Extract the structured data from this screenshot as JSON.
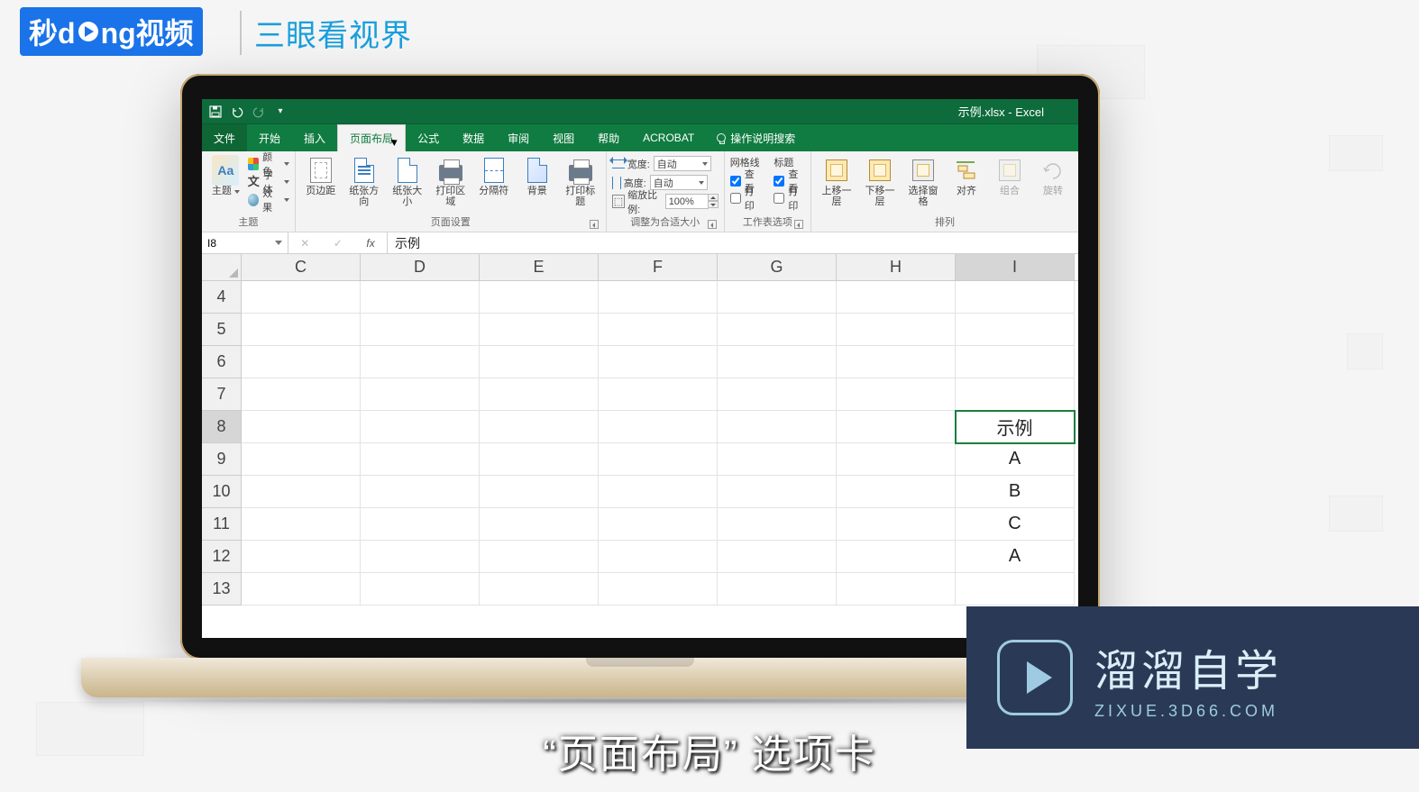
{
  "overlay": {
    "logo_left": "秒d",
    "logo_right": "ng视频",
    "tagline": "三眼看视界",
    "subtitle": "“页面布局” 选项卡"
  },
  "watermark": {
    "title": "溜溜自学",
    "url": "ZIXUE.3D66.COM"
  },
  "app": {
    "title": "示例.xlsx - Excel",
    "tabs": [
      "文件",
      "开始",
      "插入",
      "页面布局",
      "公式",
      "数据",
      "审阅",
      "视图",
      "帮助",
      "ACROBAT"
    ],
    "active_tab_index": 3,
    "tell_me": "操作说明搜索"
  },
  "ribbon": {
    "themes": {
      "group": "主题",
      "main": "主题",
      "colors": "颜色",
      "fonts": "字体",
      "effects": "效果"
    },
    "page_setup": {
      "group": "页面设置",
      "margins": "页边距",
      "orientation": "纸张方向",
      "size": "纸张大小",
      "print_area": "打印区域",
      "breaks": "分隔符",
      "background": "背景",
      "print_titles": "打印标题"
    },
    "scale": {
      "group": "调整为合适大小",
      "width_lbl": "宽度:",
      "height_lbl": "高度:",
      "scale_lbl": "缩放比例:",
      "auto": "自动",
      "percent": "100%"
    },
    "sheet_opts": {
      "group": "工作表选项",
      "gridlines": "网格线",
      "headings": "标题",
      "view": "查看",
      "print": "打印",
      "grid_view": true,
      "grid_print": false,
      "head_view": true,
      "head_print": false
    },
    "arrange": {
      "group": "排列",
      "forward": "上移一层",
      "backward": "下移一层",
      "selection": "选择窗格",
      "align": "对齐",
      "group_btn": "组合",
      "rotate": "旋转"
    }
  },
  "formula_bar": {
    "name_box": "I8",
    "value": "示例"
  },
  "grid": {
    "columns": [
      "C",
      "D",
      "E",
      "F",
      "G",
      "H",
      "I"
    ],
    "rows": [
      4,
      5,
      6,
      7,
      8,
      9,
      10,
      11,
      12,
      13
    ],
    "active": {
      "row": 8,
      "col": "I"
    },
    "cells": {
      "I8": "示例",
      "I9": "A",
      "I10": "B",
      "I11": "C",
      "I12": "A"
    }
  }
}
